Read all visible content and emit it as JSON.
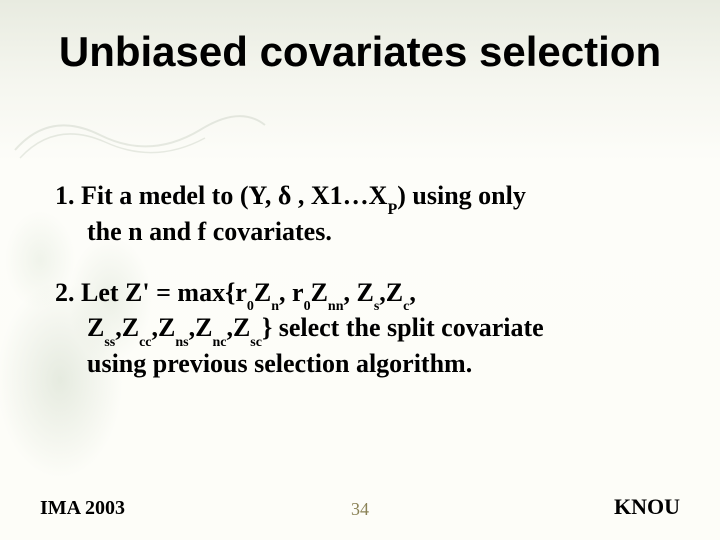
{
  "title": "Unbiased covariates selection",
  "point1_a": "1. Fit a medel to (Y, ",
  "point1_delta": "δ",
  "point1_b": " , X1…X",
  "point1_psub": "P",
  "point1_c": ") using only",
  "point1_line2": "the n and f covariates.",
  "point2_a": "2. Let Z' = max{r",
  "sub0": "0",
  "subn": "n",
  "subnn": "nn",
  "subs": "s",
  "subc": "c",
  "subss": "ss",
  "subcc": "cc",
  "subns": "ns",
  "subnc": "nc",
  "subsc": "sc",
  "z": "Z",
  "r": "r",
  "comma": ", ",
  "comma2": ",",
  "brace_close": "} ",
  "point2_tail1": "select the split covariate",
  "point2_tail2": "using previous selection algorithm.",
  "footer": {
    "left": "IMA 2003",
    "center": "34",
    "right": "KNOU"
  }
}
